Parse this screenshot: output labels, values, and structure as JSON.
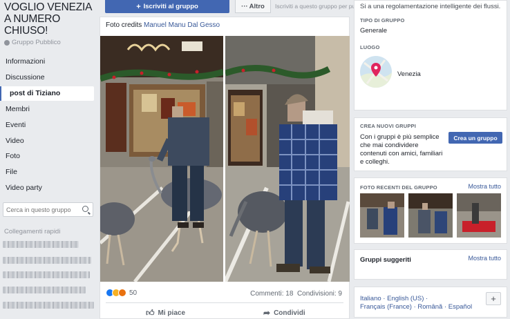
{
  "group": {
    "title": "VOGLIO VENEZIA A NUMERO CHIUSO!",
    "type": "Gruppo Pubblico"
  },
  "nav": {
    "items": [
      {
        "label": "Informazioni"
      },
      {
        "label": "Discussione"
      },
      {
        "label": "post di Tiziano"
      },
      {
        "label": "Membri"
      },
      {
        "label": "Eventi"
      },
      {
        "label": "Video"
      },
      {
        "label": "Foto"
      },
      {
        "label": "File"
      },
      {
        "label": "Video party"
      }
    ],
    "active_index": 2
  },
  "search": {
    "placeholder": "Cerca in questo gruppo",
    "icon": "search-icon"
  },
  "quick_links": {
    "title": "Collegamenti rapidi"
  },
  "topbar": {
    "join_label": "Iscriviti al gruppo",
    "more_label": "Altro",
    "hint": "Iscriviti a questo gruppo per pubblicare e commentare."
  },
  "post": {
    "credits_prefix": "Foto credits",
    "credits_author": "Manuel Manu Dal Gesso",
    "reaction_count": "50",
    "comments": "Commenti: 18",
    "shares": "Condivisioni: 9",
    "like_label": "Mi piace",
    "share_label": "Condividi",
    "reaction_colors": [
      "#1877f2",
      "#f7b125",
      "#e9710f"
    ]
  },
  "about": {
    "line1": "Si a una regolamentazione intelligente dei flussi.",
    "type_title": "TIPO DI GRUPPO",
    "type_value": "Generale",
    "location_title": "LUOGO",
    "location_value": "Venezia"
  },
  "create": {
    "title": "CREA NUOVI GRUPPI",
    "text": [
      "Con i gruppi è più semplice",
      "che mai condividere",
      "contenuti con amici, familiari",
      "e colleghi."
    ],
    "button": "Crea un gruppo"
  },
  "recent_photos": {
    "title": "FOTO RECENTI DEL GRUPPO",
    "see_all": "Mostra tutto"
  },
  "suggested": {
    "title": "Gruppi suggeriti",
    "see_all": "Mostra tutto"
  },
  "languages": {
    "line1": "Italiano · English (US) ·",
    "line2": "Français (France) · Română · Español",
    "add": "+"
  },
  "colors": {
    "brand_blue": "#4267b2",
    "link_blue": "#385898",
    "page_bg": "#e9ebee"
  }
}
